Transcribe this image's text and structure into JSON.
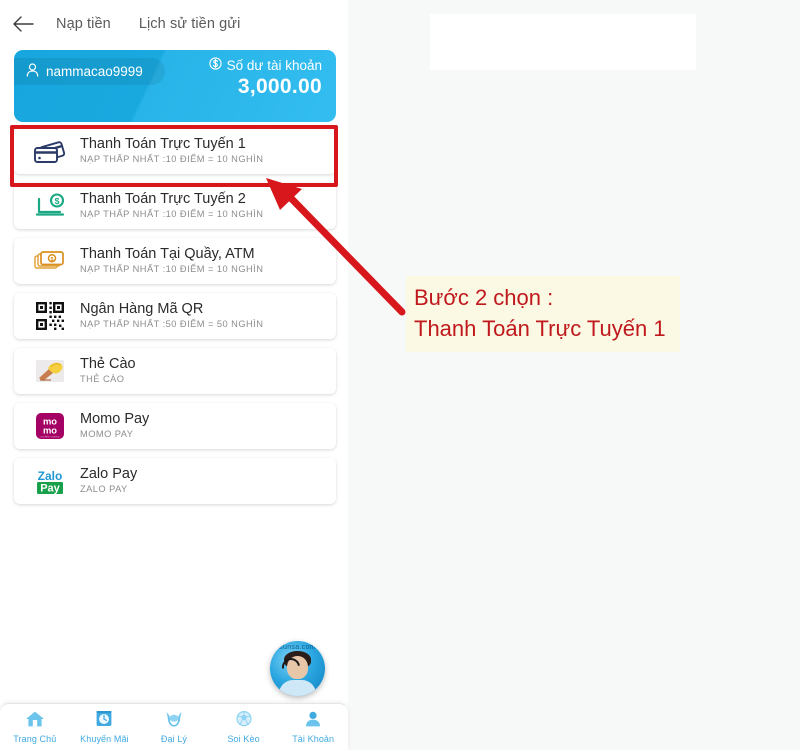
{
  "colors": {
    "brand_blue": "#19a9df",
    "accent_red": "#d7171c",
    "nav_blue": "#3fa9e0",
    "note_bg": "#fbf8e3",
    "note_text": "#c0191d"
  },
  "phone": {
    "top_bar": {
      "back_icon": "back-arrow-icon",
      "tabs": [
        {
          "label": "Nạp tiền",
          "active": true
        },
        {
          "label": "Lịch sử tiền gửi",
          "active": false
        }
      ]
    },
    "balance_card": {
      "user_icon": "user-icon",
      "username": "nammacao9999",
      "balance_icon": "dollar-circle-icon",
      "balance_label": "Số dư tài khoản",
      "balance_amount": "3,000.00"
    },
    "payment_methods": [
      {
        "icon": "credit-cards-icon",
        "title": "Thanh Toán Trực Tuyến 1",
        "subtitle": "NẠP THẤP NHẤT :10 ĐIỂM = 10 NGHÌN",
        "selected": true
      },
      {
        "icon": "laptop-dollar-icon",
        "title": "Thanh Toán Trực Tuyến 2",
        "subtitle": "NẠP THẤP NHẤT :10 ĐIỂM = 10 NGHÌN",
        "selected": false
      },
      {
        "icon": "banknotes-icon",
        "title": "Thanh Toán Tại Quầy, ATM",
        "subtitle": "NẠP THẤP NHẤT :10 ĐIỂM = 10 NGHÌN",
        "selected": false
      },
      {
        "icon": "qr-code-icon",
        "title": "Ngân Hàng Mã QR",
        "subtitle": "NẠP THẤP NHẤT :50 ĐIỂM = 50 NGHÌN",
        "selected": false
      },
      {
        "icon": "scratch-card-icon",
        "title": "Thẻ Cào",
        "subtitle": "THẺ CÀO",
        "selected": false
      },
      {
        "icon": "momo-logo-icon",
        "title": "Momo Pay",
        "subtitle": "MOMO PAY",
        "selected": false
      },
      {
        "icon": "zalopay-logo-icon",
        "title": "Zalo Pay",
        "subtitle": "ZALO PAY",
        "selected": false
      }
    ],
    "support_avatar": {
      "icon": "support-agent-avatar",
      "ring_text": "sunsa.com"
    },
    "bottom_nav": [
      {
        "icon": "home-icon",
        "label": "Trang Chủ"
      },
      {
        "icon": "gift-icon",
        "label": "Khuyến Mãi"
      },
      {
        "icon": "handshake-icon",
        "label": "Đại Lý"
      },
      {
        "icon": "soccer-ball-icon",
        "label": "Soi Kèo"
      },
      {
        "icon": "person-icon",
        "label": "Tài Khoản"
      }
    ]
  },
  "annotation": {
    "note_line_1": "Bước 2 chọn :",
    "note_line_2": "Thanh Toán Trực Tuyến 1",
    "arrow_icon": "red-arrow-icon",
    "highlight_icon": "red-highlight-box"
  }
}
